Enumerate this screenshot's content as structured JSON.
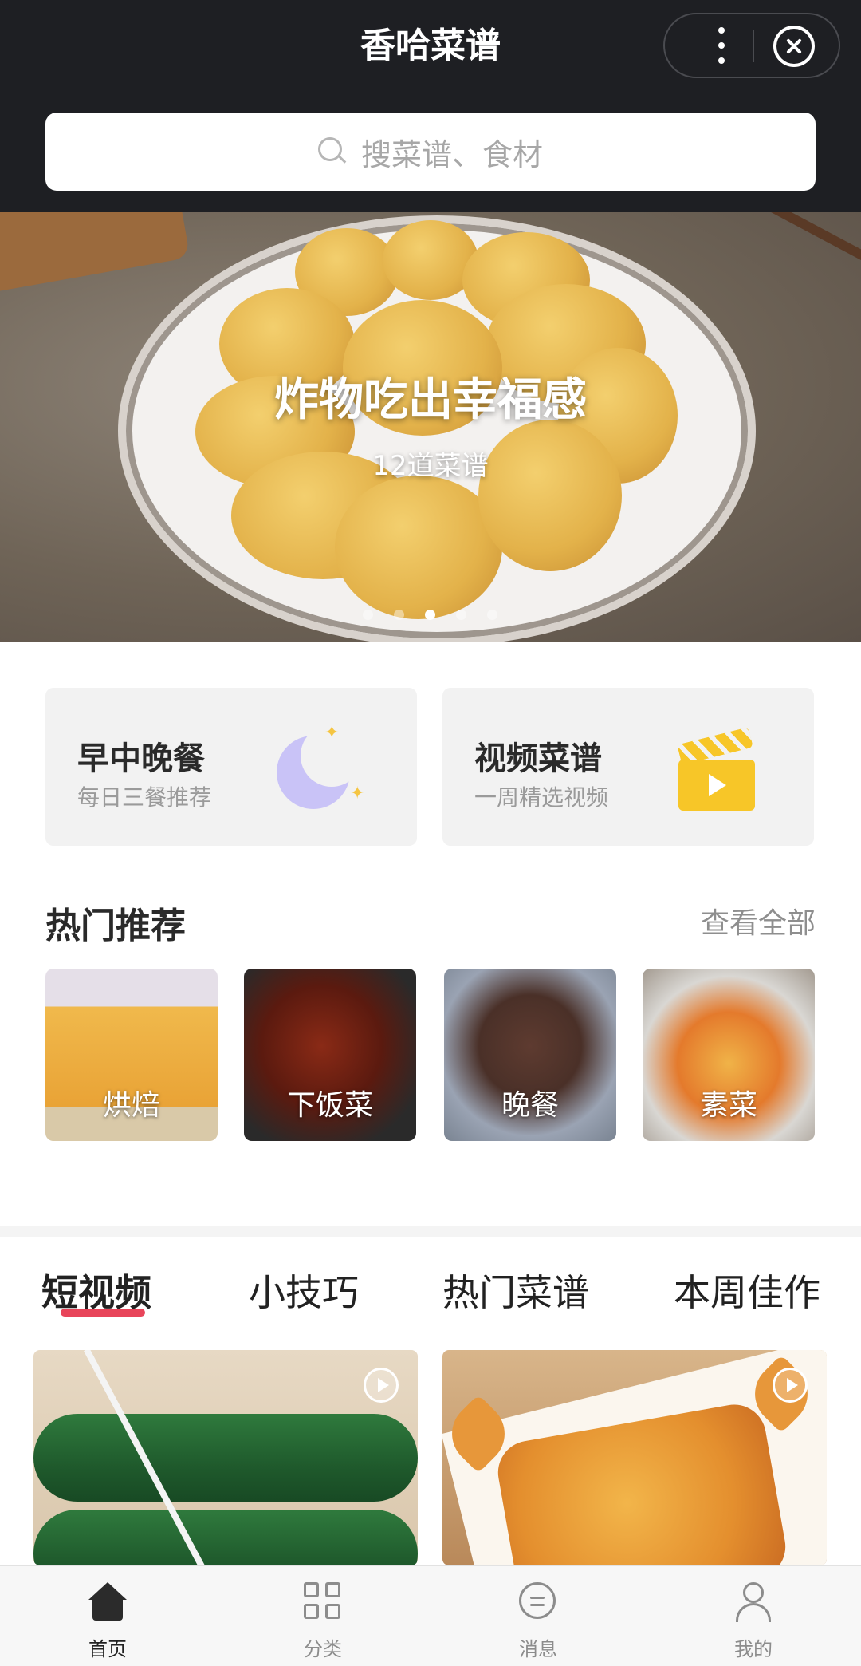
{
  "header": {
    "title": "香哈菜谱",
    "more_icon": "more-vertical-icon",
    "close_icon": "close-circle-icon"
  },
  "search": {
    "placeholder": "搜菜谱、食材",
    "icon": "search-icon"
  },
  "banner": {
    "title": "炸物吃出幸福感",
    "subtitle": "12道菜谱",
    "slide_count": 5,
    "active_slide": 3
  },
  "features": [
    {
      "title": "早中晚餐",
      "subtitle": "每日三餐推荐",
      "icon": "moon-icon"
    },
    {
      "title": "视频菜谱",
      "subtitle": "一周精选视频",
      "icon": "clapperboard-icon"
    }
  ],
  "hot": {
    "title": "热门推荐",
    "view_all": "查看全部",
    "items": [
      {
        "label": "烘焙"
      },
      {
        "label": "下饭菜"
      },
      {
        "label": "晚餐"
      },
      {
        "label": "素菜"
      }
    ]
  },
  "tabs": [
    {
      "label": "短视频",
      "active": true
    },
    {
      "label": "小技巧",
      "active": false
    },
    {
      "label": "热门菜谱",
      "active": false
    },
    {
      "label": "本周佳作",
      "active": false
    }
  ],
  "videos": [
    {
      "icon": "play-icon"
    },
    {
      "icon": "play-icon"
    }
  ],
  "nav": [
    {
      "label": "首页",
      "icon": "home-icon",
      "active": true
    },
    {
      "label": "分类",
      "icon": "grid-icon",
      "active": false
    },
    {
      "label": "消息",
      "icon": "message-icon",
      "active": false
    },
    {
      "label": "我的",
      "icon": "user-icon",
      "active": false
    }
  ],
  "colors": {
    "header_bg": "#1e1f23",
    "accent": "#e8455a",
    "feature_bg": "#f2f2f2"
  }
}
